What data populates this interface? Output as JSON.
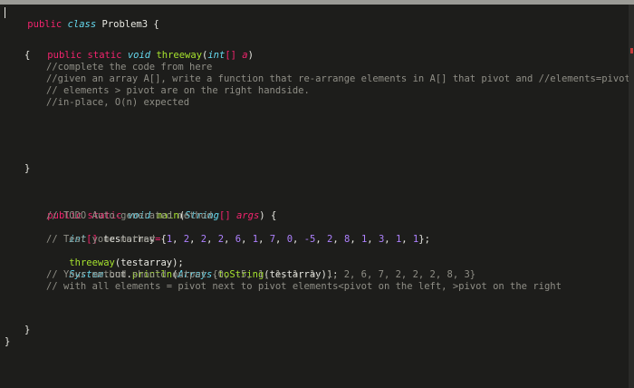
{
  "editor": {
    "class_decl": {
      "kw": "public",
      "kw2": "class",
      "name": "Problem3",
      "brace": "{"
    },
    "threeway_sig": {
      "kw": "public static",
      "ret": "void",
      "name": "threeway",
      "lp": "(",
      "ptype": "int",
      "brk": "[]",
      "param": "a",
      "rp": ")"
    },
    "open_brace_1": "{",
    "comment_1": "//complete the code from here",
    "comment_2": "//given an array A[], write a function that re-arrange elements in A[] that pivot and //elements=pivot are pla",
    "comment_3": "// elements > pivot are on the right handside.",
    "comment_4": "//in-place, O(n) expected",
    "close_brace_1": "}",
    "main_sig": {
      "kw": "public static",
      "ret": "void",
      "name": "main",
      "lp": "(",
      "ptype": "String",
      "brk": "[]",
      "param": "args",
      "rp": ")",
      "brace": "{"
    },
    "comment_5": "// TODO Auto-generated method",
    "decl_line": {
      "type": "int",
      "brk": "[]",
      "var": "testarray",
      "eq": "=",
      "open": "{",
      "values": [
        "1",
        "2",
        "2",
        "2",
        "6",
        "1",
        "7",
        "0",
        "-5",
        "2",
        "8",
        "1",
        "3",
        "1",
        "1"
      ],
      "close": "};"
    },
    "comment_6": "// Test your method",
    "call_line": {
      "name": "threeway",
      "args": "(testarray);"
    },
    "print_line": {
      "sys": "System",
      "dot1": ".out.",
      "fn": "println",
      "lp": "(",
      "cls": "Arrays",
      "dot2": ".",
      "fn2": "toString",
      "args": "(testarray));"
    },
    "comment_7": "// Your method should output {0, -5, 1, 1, 1, 1, 1, 2, 6, 7, 2, 2, 2, 8, 3}",
    "comment_8": "// with all elements = pivot next to pivot elements<pivot on the left, >pivot on the right",
    "close_brace_2": "}",
    "close_brace_3": "}"
  }
}
